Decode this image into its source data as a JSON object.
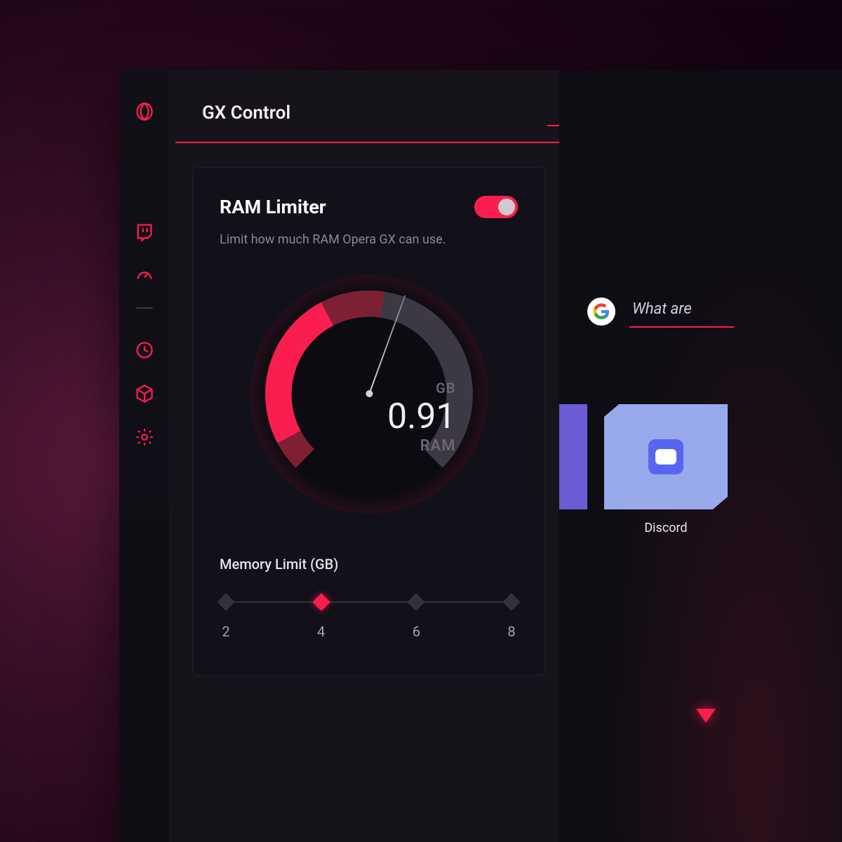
{
  "colors": {
    "accent": "#fa1e4e",
    "panel_bg": "#121018",
    "text": "#f2eef4",
    "muted": "#8e8795"
  },
  "sidebar": {
    "icons": [
      "opera-logo-icon",
      "twitch-icon",
      "gauge-icon",
      "clock-icon",
      "cube-icon",
      "gear-icon"
    ]
  },
  "panel": {
    "title": "GX Control",
    "card": {
      "title": "RAM Limiter",
      "toggle_on": true,
      "description": "Limit how much RAM Opera GX can use.",
      "gauge": {
        "unit": "GB",
        "value": "0.91",
        "label": "RAM"
      },
      "slider": {
        "title": "Memory Limit (GB)",
        "ticks": [
          "2",
          "4",
          "6",
          "8"
        ],
        "active_index": 1
      }
    }
  },
  "content": {
    "search": {
      "engine": "google",
      "placeholder": "What are"
    },
    "speed_dial": [
      {
        "name": "Discord",
        "color": "#98a9ec"
      }
    ]
  }
}
